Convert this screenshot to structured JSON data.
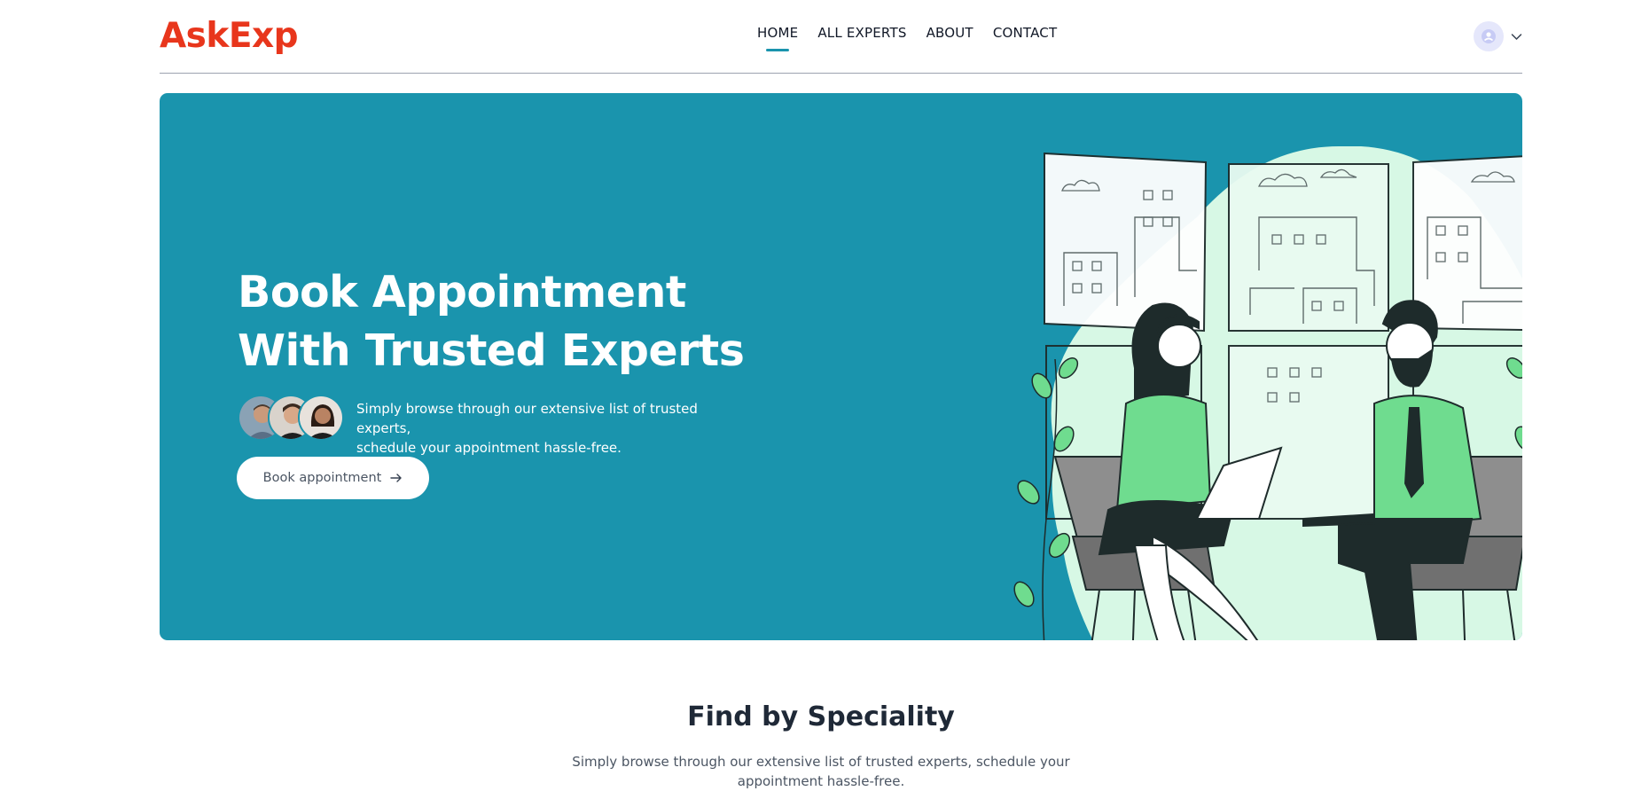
{
  "header": {
    "logo": "AskExp",
    "nav": [
      {
        "label": "HOME",
        "active": true
      },
      {
        "label": "ALL EXPERTS",
        "active": false
      },
      {
        "label": "ABOUT",
        "active": false
      },
      {
        "label": "CONTACT",
        "active": false
      }
    ],
    "profile_icon": "user-icon",
    "dropdown_icon": "chevron-down-icon"
  },
  "hero": {
    "title_line1": "Book Appointment",
    "title_line2": "With Trusted Experts",
    "desc_line1": "Simply browse through our extensive list of trusted experts,",
    "desc_line2": "schedule your appointment hassle-free.",
    "button_label": "Book appointment",
    "button_icon": "arrow-right-icon",
    "background_color": "#1a94ad"
  },
  "speciality": {
    "title": "Find by Speciality",
    "desc_line1": "Simply browse through our extensive list of trusted experts, schedule your",
    "desc_line2": "appointment hassle-free."
  },
  "colors": {
    "brand": "#e8361c",
    "accent": "#1a94ad",
    "mint": "#d7f8e5",
    "green": "#6fdc8f",
    "dark": "#1e2b2b"
  }
}
